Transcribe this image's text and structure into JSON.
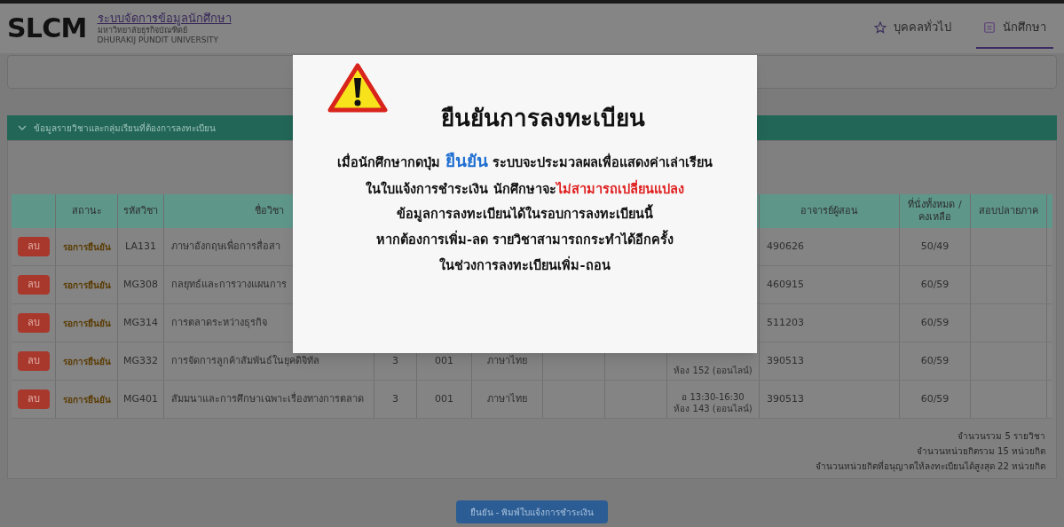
{
  "header": {
    "logo": "SLCM",
    "title": "ระบบจัดการข้อมูลนักศึกษา",
    "subtitle": "มหาวิทยาลัยธุรกิจบัณฑิตย์",
    "subtitle_en": "DHURAKIJ PUNDIT UNIVERSITY"
  },
  "nav": [
    {
      "label": "บุคคลทั่วไป",
      "selected": false
    },
    {
      "label": "นักศึกษา",
      "selected": true
    }
  ],
  "section": {
    "title": "ข้อมูลรายวิชาและกลุ่มเรียนที่ต้องการลงทะเบียน",
    "expanded": true
  },
  "table": {
    "columns": {
      "status": "สถานะ",
      "code": "รหัสวิชา",
      "name": "ชื่อวิชา",
      "instructor": "อาจารย์ผู้สอน",
      "seats": "ที่นั่งทั้งหมด / คงเหลือ",
      "exam": "สอบปลายภาค"
    },
    "rows": [
      {
        "action": "ลบ",
        "status": "รอการยืนยัน",
        "code": "LA131",
        "name": "ภาษาอังกฤษเพื่อการสื่อสา",
        "instructor": "490626",
        "seats": "50/49"
      },
      {
        "action": "ลบ",
        "status": "รอการยืนยัน",
        "code": "MG308",
        "name": "กลยุทธ์และการวางแผนการ",
        "instructor": "460915",
        "seats": "60/59"
      },
      {
        "action": "ลบ",
        "status": "รอการยืนยัน",
        "code": "MG314",
        "name": "การตลาดระหว่างธุรกิจ",
        "instructor": "511203",
        "seats": "60/59"
      },
      {
        "action": "ลบ",
        "status": "รอการยืนยัน",
        "code": "MG332",
        "name": "การจัดการลูกค้าสัมพันธ์ในยุคดิจิทัล",
        "credits": "3",
        "section": "001",
        "language": "ภาษาไทย",
        "schedule": [
          "ห้อง 152 (ออนไลน์)"
        ],
        "instructor": "390513",
        "seats": "60/59"
      },
      {
        "action": "ลบ",
        "status": "รอการยืนยัน",
        "code": "MG401",
        "name": "สัมมนาและการศึกษาเฉพาะเรื่องทางการตลาด",
        "credits": "3",
        "section": "001",
        "language": "ภาษาไทย",
        "schedule": [
          "อ 13:30-16:30",
          "ห้อง 143 (ออนไลน์)"
        ],
        "instructor": "390513",
        "seats": "60/59"
      }
    ]
  },
  "summary": [
    "จำนวนรวม 5 รายวิชา",
    "จำนวนหน่วยกิตรวม 15 หน่วยกิต",
    "จำนวนหน่วยกิตที่อนุญาตให้ลงทะเบียนได้สูงสุด 22 หน่วยกิต"
  ],
  "confirm_button": "ยืนยัน - พิมพ์ใบแจ้งการชำระเงิน",
  "dialog": {
    "title": "ยืนยันการลงทะเบียน",
    "lines": [
      [
        {
          "text": "เมื่อนักศึกษากดปุ่ม ",
          "kind": "normal"
        },
        {
          "text": "ยืนยัน",
          "kind": "highlight"
        },
        {
          "text": " ระบบจะประมวลผลเพื่อแสดงค่าเล่าเรียน",
          "kind": "normal"
        }
      ],
      [
        {
          "text": "ในใบแจ้งการชำระเงิน นักศึกษาจะ",
          "kind": "normal"
        },
        {
          "text": "ไม่สามารถเปลี่ยนแปลง",
          "kind": "warning"
        }
      ],
      [
        {
          "text": "ข้อมูลการลงทะเบียนได้ในรอบการลงทะเบียนนี้",
          "kind": "normal"
        }
      ],
      [
        {
          "text": "หากต้องการเพิ่ม-ลด รายวิชาสามารถกระทำได้อีกครั้ง",
          "kind": "normal"
        }
      ],
      [
        {
          "text": "ในช่วงการลงทะเบียนเพิ่ม-ถอน",
          "kind": "normal"
        }
      ]
    ]
  }
}
